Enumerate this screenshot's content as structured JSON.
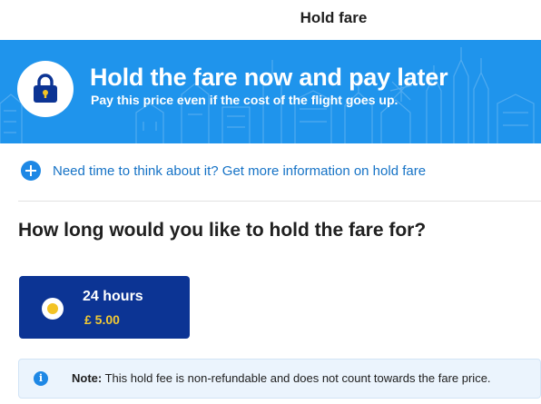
{
  "header": {
    "title": "Hold fare"
  },
  "banner": {
    "title": "Hold the fare now and pay later",
    "subtitle": "Pay this price even if the cost of the flight goes up.",
    "icon": "lock-icon",
    "background_color": "#1f94ec"
  },
  "info_link": {
    "text": "Need time to think about it? Get more information on hold fare",
    "icon": "plus-circle-icon"
  },
  "hold_section": {
    "question": "How long would you like to hold the fare for?",
    "options": [
      {
        "duration": "24 hours",
        "price": "£ 5.00",
        "selected": true
      }
    ]
  },
  "note": {
    "icon": "info-icon",
    "label": "Note:",
    "text": "This hold fee is non-refundable and does not count towards the fare price."
  },
  "colors": {
    "accent": "#1e88e5",
    "option_bg": "#0c3494",
    "price": "#f1c933"
  }
}
